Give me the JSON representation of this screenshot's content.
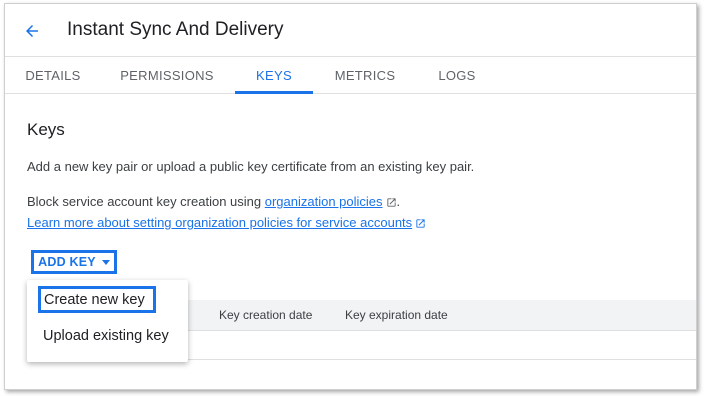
{
  "header": {
    "title": "Instant Sync And Delivery",
    "back_icon": "arrow-back-icon"
  },
  "tabs": [
    {
      "label": "DETAILS",
      "active": false
    },
    {
      "label": "PERMISSIONS",
      "active": false
    },
    {
      "label": "KEYS",
      "active": true
    },
    {
      "label": "METRICS",
      "active": false
    },
    {
      "label": "LOGS",
      "active": false
    }
  ],
  "keys_section": {
    "title": "Keys",
    "description": "Add a new key pair or upload a public key certificate from an existing key pair.",
    "policy_prefix": "Block service account key creation using ",
    "policy_link": "organization policies",
    "policy_suffix": ".",
    "learn_more_link": "Learn more about setting organization policies for service accounts",
    "external_icon": "open-in-new-icon"
  },
  "add_key": {
    "label": "ADD KEY",
    "icon": "caret-down-icon",
    "menu": [
      "Create new key",
      "Upload existing key"
    ]
  },
  "table": {
    "columns": [
      "Key creation date",
      "Key expiration date"
    ]
  },
  "colors": {
    "accent": "#1a73e8",
    "text": "#202124",
    "muted": "#5f6368",
    "table_header_bg": "#f1f3f4"
  }
}
